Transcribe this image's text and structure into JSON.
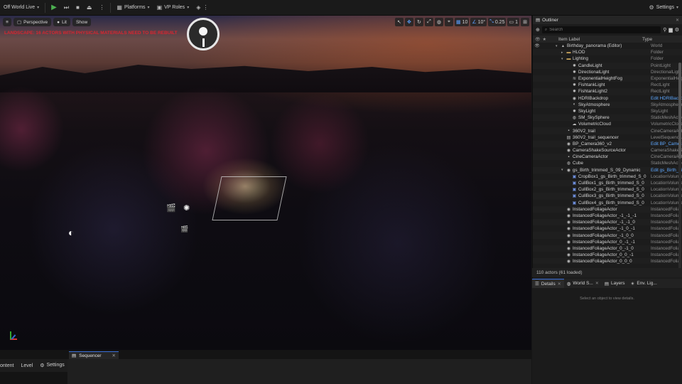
{
  "toolbar": {
    "world": "Off World Live",
    "platforms": "Platforms",
    "vp_roles": "VP Roles",
    "settings": "Settings"
  },
  "viewport": {
    "perspective": "Perspective",
    "lit": "Lit",
    "show": "Show",
    "warning": "LANDSCAPE: 16 ACTORS WITH PHYSICAL MATERIALS NEED TO BE REBUILT",
    "grid_snap": "10",
    "rot_snap": "10°",
    "scale_snap": "0.25",
    "camera_speed": "1"
  },
  "outliner": {
    "title": "Outliner",
    "search_placeholder": "Search",
    "col_label": "Item Label",
    "col_type": "Type",
    "count": "110 actors (61 loaded)",
    "rows": [
      {
        "label": "Birthday_panorama (Editor)",
        "type": "World",
        "indent": 0,
        "icon": "world",
        "caret": "▾"
      },
      {
        "label": "HLOD",
        "type": "Folder",
        "indent": 1,
        "icon": "folder",
        "caret": "▸"
      },
      {
        "label": "Lighting",
        "type": "Folder",
        "indent": 1,
        "icon": "folder",
        "caret": "▾"
      },
      {
        "label": "CandleLight",
        "type": "PointLight",
        "indent": 2,
        "icon": "light",
        "caret": ""
      },
      {
        "label": "DirectionalLight",
        "type": "DirectionalLight",
        "indent": 2,
        "icon": "light",
        "caret": ""
      },
      {
        "label": "ExponentialHeightFog",
        "type": "ExponentialHeig",
        "indent": 2,
        "icon": "fog",
        "caret": ""
      },
      {
        "label": "FishtankLight",
        "type": "RectLight",
        "indent": 2,
        "icon": "light",
        "caret": ""
      },
      {
        "label": "FishtankLight2",
        "type": "RectLight",
        "indent": 2,
        "icon": "light",
        "caret": ""
      },
      {
        "label": "HDRIBackdrop",
        "type": "Edit HDRIBackd",
        "indent": 2,
        "icon": "actor",
        "caret": "",
        "edit": true
      },
      {
        "label": "SkyAtmosphere",
        "type": "SkyAtmosphere",
        "indent": 2,
        "icon": "sky",
        "caret": ""
      },
      {
        "label": "SkyLight",
        "type": "SkyLight",
        "indent": 2,
        "icon": "light",
        "caret": ""
      },
      {
        "label": "SM_SkySphere",
        "type": "StaticMeshActo",
        "indent": 2,
        "icon": "mesh",
        "caret": ""
      },
      {
        "label": "VolumetricCloud",
        "type": "VolumetricCloud",
        "indent": 2,
        "icon": "cloud",
        "caret": ""
      },
      {
        "label": "360V2_trail",
        "type": "CineCameraActo",
        "indent": 1,
        "icon": "camera",
        "caret": ""
      },
      {
        "label": "360V2_trail_sequencer",
        "type": "LevelSequenceA",
        "indent": 1,
        "icon": "seq",
        "caret": ""
      },
      {
        "label": "BP_Camera360_v2",
        "type": "Edit BP_Camera",
        "indent": 1,
        "icon": "actor",
        "caret": "",
        "edit": true
      },
      {
        "label": "CameraShakeSourceActor",
        "type": "CameraShakeSo",
        "indent": 1,
        "icon": "actor",
        "caret": ""
      },
      {
        "label": "CineCameraActor",
        "type": "CineCameraActo",
        "indent": 1,
        "icon": "camera",
        "caret": ""
      },
      {
        "label": "Cube",
        "type": "StaticMeshActo",
        "indent": 1,
        "icon": "mesh",
        "caret": ""
      },
      {
        "label": "gs_Birth_trimmed_S_09_Dynamic",
        "type": "Edit gs_Birth_tri",
        "indent": 1,
        "icon": "actor",
        "caret": "▾",
        "edit": true
      },
      {
        "label": "CropBox1_gs_Birth_trimmed_S_0",
        "type": "LocationVolume",
        "indent": 2,
        "icon": "cull",
        "caret": ""
      },
      {
        "label": "CullBox1_gs_Birth_trimmed_S_0",
        "type": "LocationVolume",
        "indent": 2,
        "icon": "cull",
        "caret": ""
      },
      {
        "label": "CullBox2_gs_Birth_trimmed_S_0",
        "type": "LocationVolume",
        "indent": 2,
        "icon": "cull",
        "caret": ""
      },
      {
        "label": "CullBox3_gs_Birth_trimmed_S_0",
        "type": "LocationVolume",
        "indent": 2,
        "icon": "cull",
        "caret": ""
      },
      {
        "label": "CullBox4_gs_Birth_trimmed_S_0",
        "type": "LocationVolume",
        "indent": 2,
        "icon": "cull",
        "caret": ""
      },
      {
        "label": "InstancedFoliageActor",
        "type": "InstancedFolia",
        "indent": 1,
        "icon": "actor",
        "caret": ""
      },
      {
        "label": "InstancedFoliageActor_-1_-1_-1",
        "type": "InstancedFolia",
        "indent": 1,
        "icon": "actor",
        "caret": ""
      },
      {
        "label": "InstancedFoliageActor_-1_-1_0",
        "type": "InstancedFolia",
        "indent": 1,
        "icon": "actor",
        "caret": ""
      },
      {
        "label": "InstancedFoliageActor_-1_0_-1",
        "type": "InstancedFolia",
        "indent": 1,
        "icon": "actor",
        "caret": ""
      },
      {
        "label": "InstancedFoliageActor_-1_0_0",
        "type": "InstancedFolia",
        "indent": 1,
        "icon": "actor",
        "caret": ""
      },
      {
        "label": "InstancedFoliageActor_0_-1_-1",
        "type": "InstancedFolia",
        "indent": 1,
        "icon": "actor",
        "caret": ""
      },
      {
        "label": "InstancedFoliageActor_0_-1_0",
        "type": "InstancedFolia",
        "indent": 1,
        "icon": "actor",
        "caret": ""
      },
      {
        "label": "InstancedFoliageActor_0_0_-1",
        "type": "InstancedFolia",
        "indent": 1,
        "icon": "actor",
        "caret": ""
      },
      {
        "label": "InstancedFoliageActor_0_0_0",
        "type": "InstancedFolia",
        "indent": 1,
        "icon": "actor",
        "caret": ""
      }
    ]
  },
  "details": {
    "tabs": [
      "Details",
      "World S...",
      "Layers",
      "Env. Lig..."
    ],
    "empty_text": "Select an object to view details."
  },
  "bottom": {
    "content": "ontent",
    "level": "Level",
    "settings": "Settings",
    "sequencer": "Sequencer"
  },
  "colors": {
    "accent": "#3a6fd8",
    "warning": "#d9262f",
    "play": "#4caf50",
    "edit_link": "#5fa8ff"
  }
}
